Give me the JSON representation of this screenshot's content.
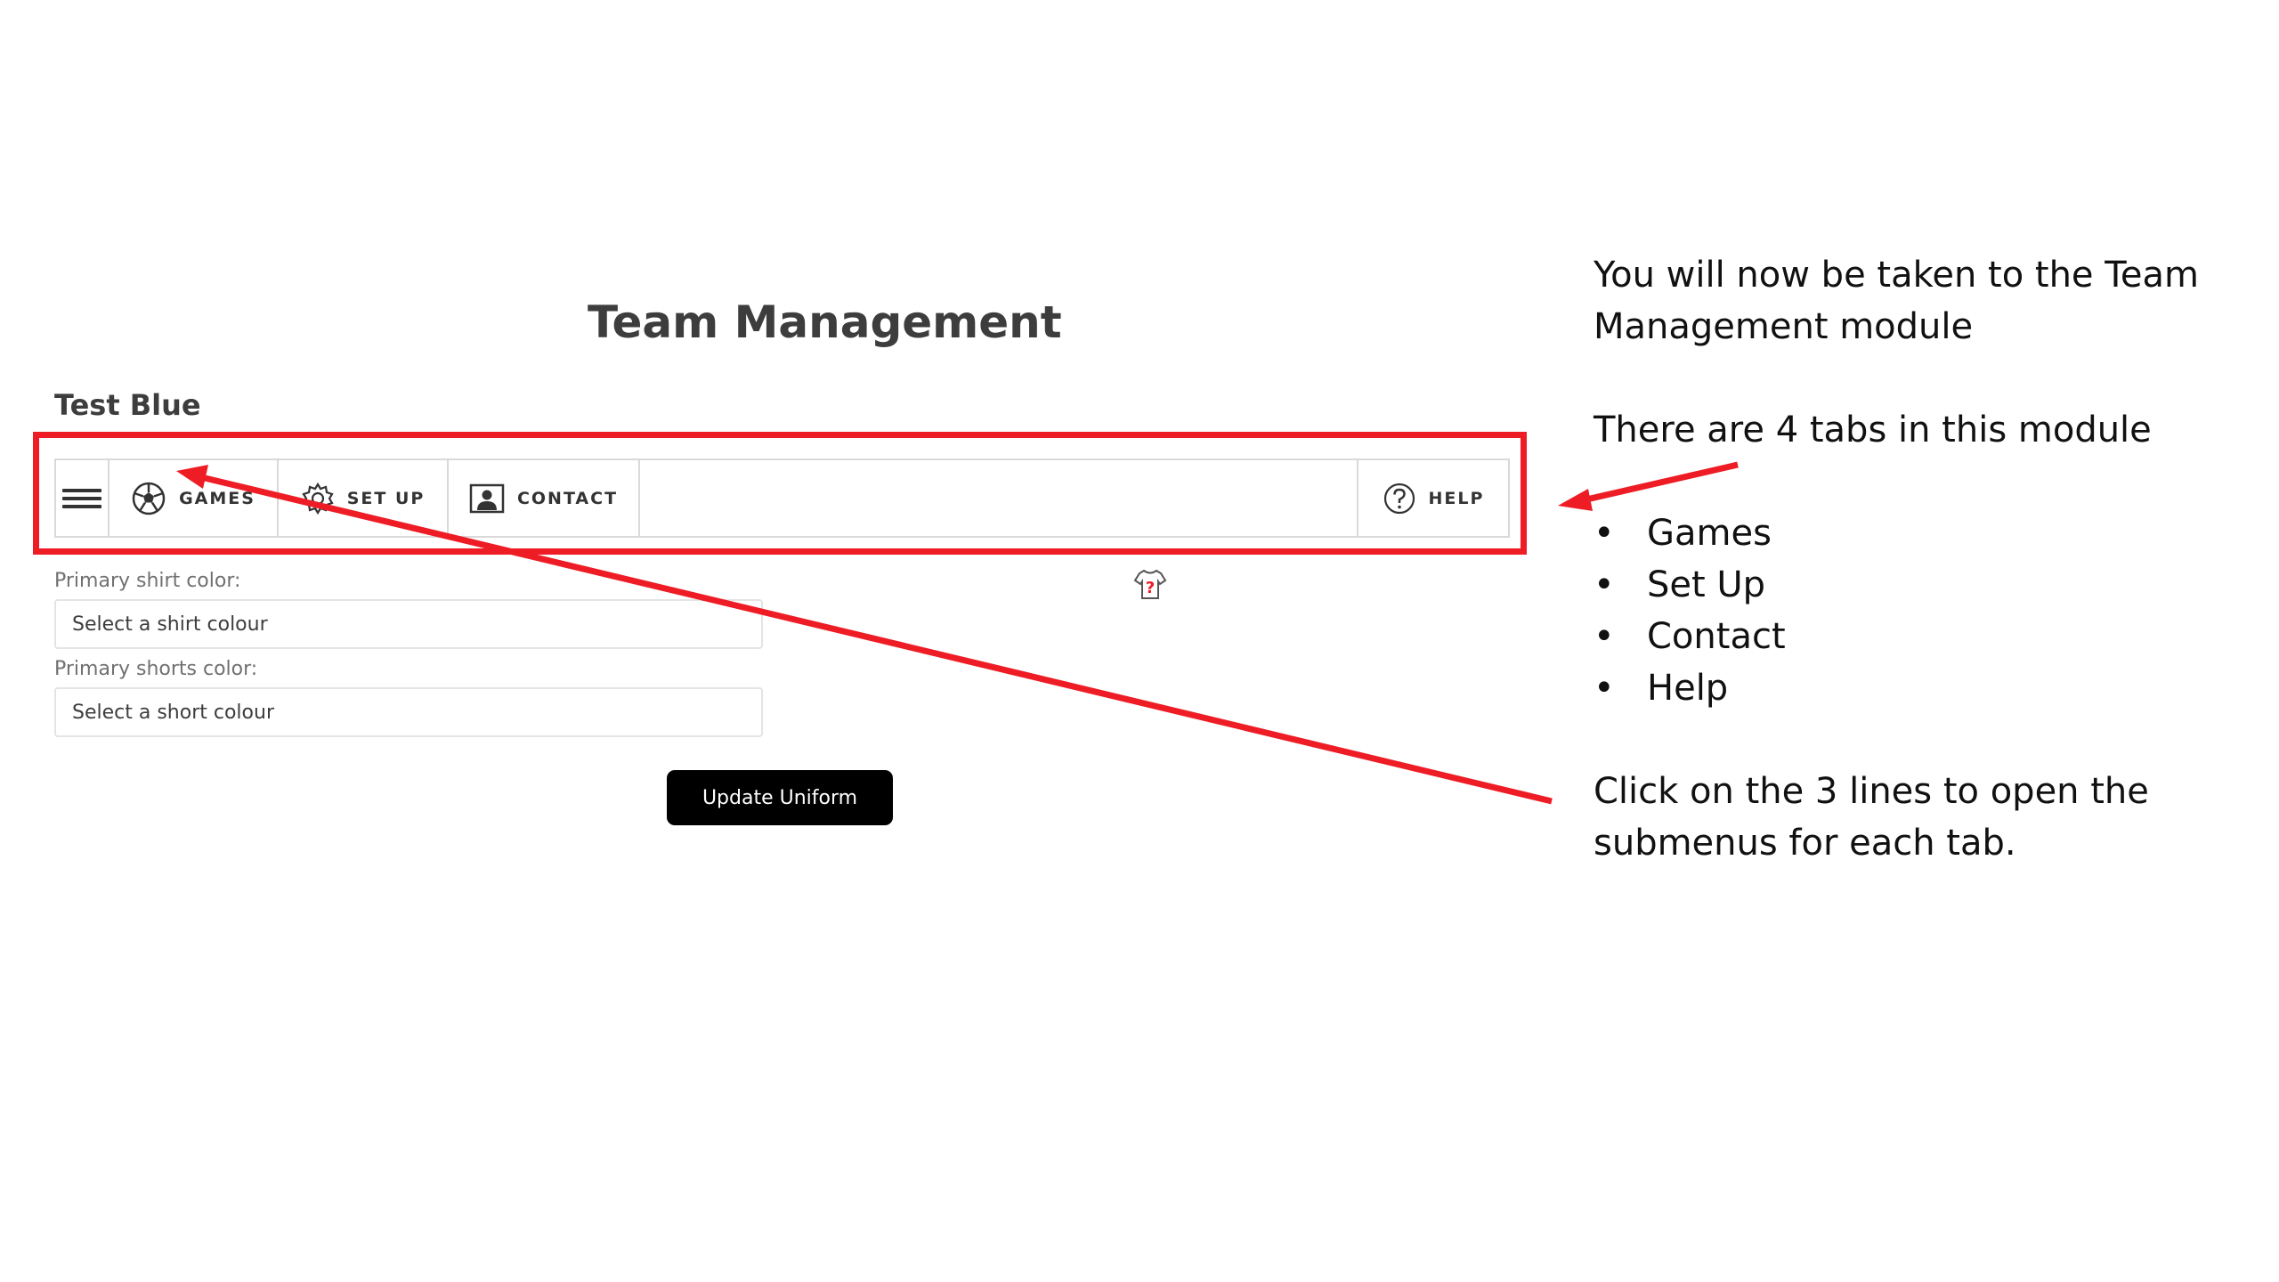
{
  "page": {
    "title": "Team Management",
    "team_name": "Test Blue"
  },
  "nav": {
    "tabs": [
      {
        "label": "GAMES",
        "icon": "soccer-ball-icon"
      },
      {
        "label": "SET UP",
        "icon": "gear-icon"
      },
      {
        "label": "CONTACT",
        "icon": "contact-card-icon"
      },
      {
        "label": "HELP",
        "icon": "question-circle-icon"
      }
    ]
  },
  "form": {
    "shirt_label": "Primary shirt color:",
    "shirt_placeholder": "Select a shirt colour",
    "shorts_label": "Primary shorts color:",
    "shorts_placeholder": "Select a short colour",
    "update_button": "Update Uniform"
  },
  "instructions": {
    "intro": "You will now be taken to the Team Management module",
    "tabs_intro": "There are 4 tabs in this module",
    "tab_list": [
      "Games",
      "Set Up",
      "Contact",
      "Help"
    ],
    "hint": "Click on the 3 lines to open the submenus for each tab."
  },
  "colors": {
    "highlight": "#ee1c24",
    "button_bg": "#000000",
    "text": "#3d3d3d"
  }
}
